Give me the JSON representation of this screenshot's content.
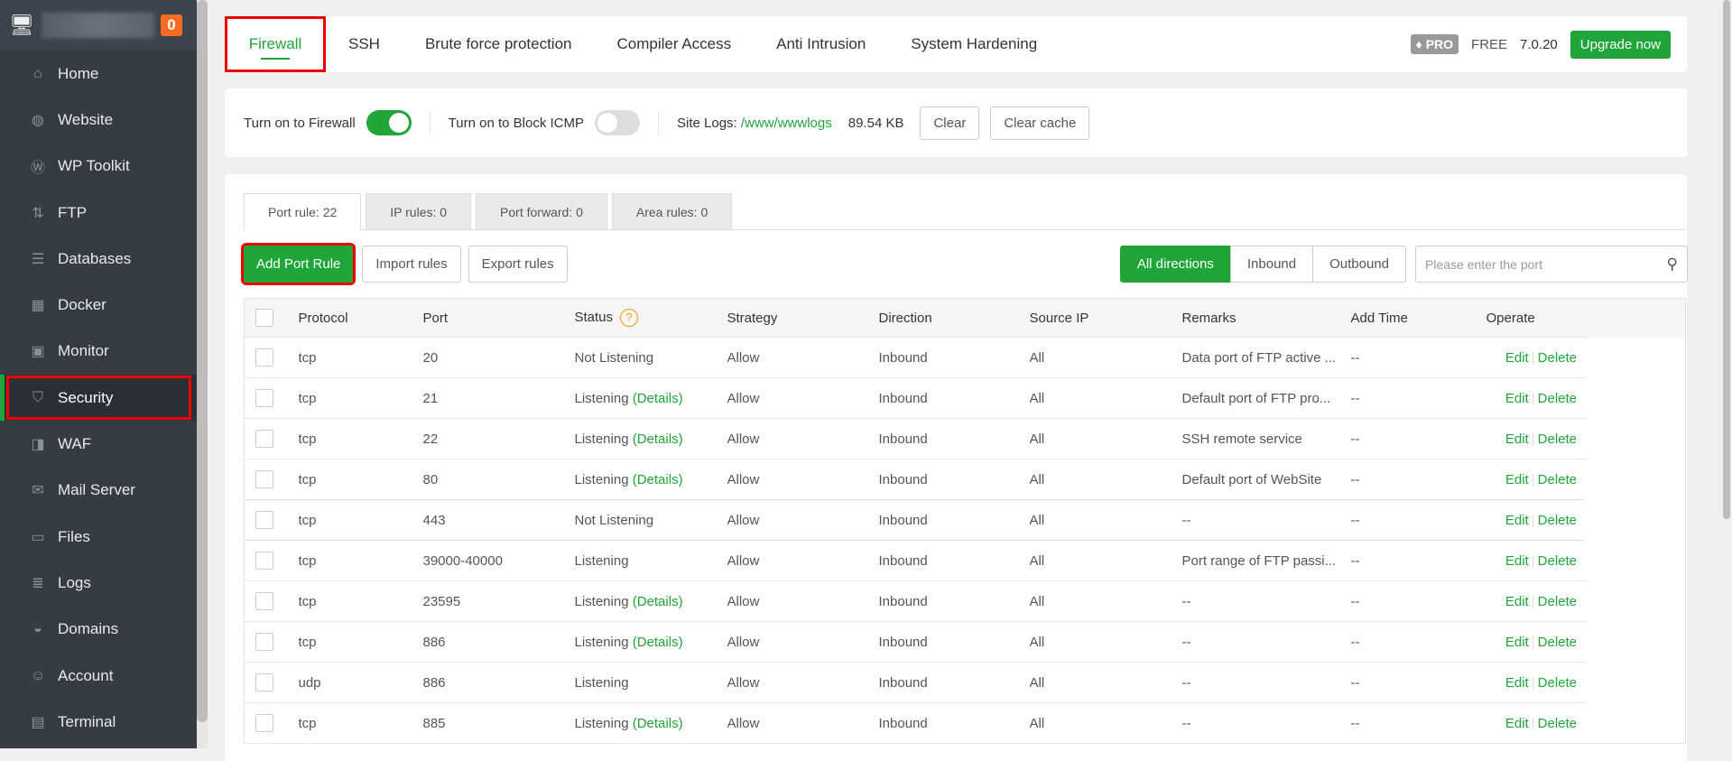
{
  "sidebar": {
    "notification_count": "0",
    "items": [
      {
        "label": "Home",
        "icon": "home-icon"
      },
      {
        "label": "Website",
        "icon": "globe-icon"
      },
      {
        "label": "WP Toolkit",
        "icon": "wordpress-icon"
      },
      {
        "label": "FTP",
        "icon": "ftp-icon"
      },
      {
        "label": "Databases",
        "icon": "database-icon"
      },
      {
        "label": "Docker",
        "icon": "docker-icon"
      },
      {
        "label": "Monitor",
        "icon": "monitor-icon"
      },
      {
        "label": "Security",
        "icon": "shield-icon"
      },
      {
        "label": "WAF",
        "icon": "waf-icon"
      },
      {
        "label": "Mail Server",
        "icon": "mail-icon"
      },
      {
        "label": "Files",
        "icon": "folder-icon"
      },
      {
        "label": "Logs",
        "icon": "logs-icon"
      },
      {
        "label": "Domains",
        "icon": "domains-icon"
      },
      {
        "label": "Account",
        "icon": "account-icon"
      },
      {
        "label": "Terminal",
        "icon": "terminal-icon"
      }
    ]
  },
  "tabs": [
    "Firewall",
    "SSH",
    "Brute force protection",
    "Compiler Access",
    "Anti Intrusion",
    "System Hardening"
  ],
  "header": {
    "pro": "PRO",
    "edition": "FREE",
    "version": "7.0.20",
    "upgrade": "Upgrade now"
  },
  "options": {
    "firewall_label": "Turn on to Firewall",
    "firewall_on": true,
    "icmp_label": "Turn on to Block ICMP",
    "icmp_on": false,
    "site_logs_label": "Site Logs:",
    "site_logs_path": "/www/wwwlogs",
    "site_logs_size": "89.54 KB",
    "clear": "Clear",
    "clear_cache": "Clear cache"
  },
  "subtabs": [
    "Port rule: 22",
    "IP rules: 0",
    "Port forward: 0",
    "Area rules: 0"
  ],
  "toolbar": {
    "add": "Add Port Rule",
    "import": "Import rules",
    "export": "Export rules",
    "directions": [
      "All directions",
      "Inbound",
      "Outbound"
    ],
    "search_placeholder": "Please enter the port"
  },
  "table": {
    "headers": [
      "Protocol",
      "Port",
      "Status",
      "Strategy",
      "Direction",
      "Source IP",
      "Remarks",
      "Add Time",
      "Operate"
    ],
    "details": "(Details)",
    "edit": "Edit",
    "delete": "Delete",
    "rows": [
      {
        "protocol": "tcp",
        "port": "20",
        "status": "Not Listening",
        "details": false,
        "strategy": "Allow",
        "direction": "Inbound",
        "source": "All",
        "remarks": "Data port of FTP active ...",
        "time": "--"
      },
      {
        "protocol": "tcp",
        "port": "21",
        "status": "Listening",
        "details": true,
        "strategy": "Allow",
        "direction": "Inbound",
        "source": "All",
        "remarks": "Default port of FTP pro...",
        "time": "--"
      },
      {
        "protocol": "tcp",
        "port": "22",
        "status": "Listening",
        "details": true,
        "strategy": "Allow",
        "direction": "Inbound",
        "source": "All",
        "remarks": "SSH remote service",
        "time": "--"
      },
      {
        "protocol": "tcp",
        "port": "80",
        "status": "Listening",
        "details": true,
        "strategy": "Allow",
        "direction": "Inbound",
        "source": "All",
        "remarks": "Default port of WebSite",
        "time": "--"
      },
      {
        "protocol": "tcp",
        "port": "443",
        "status": "Not Listening",
        "details": false,
        "strategy": "Allow",
        "direction": "Inbound",
        "source": "All",
        "remarks": "--",
        "time": "--"
      },
      {
        "protocol": "tcp",
        "port": "39000-40000",
        "status": "Listening",
        "details": false,
        "strategy": "Allow",
        "direction": "Inbound",
        "source": "All",
        "remarks": "Port range of FTP passi...",
        "time": "--"
      },
      {
        "protocol": "tcp",
        "port": "23595",
        "status": "Listening",
        "details": true,
        "strategy": "Allow",
        "direction": "Inbound",
        "source": "All",
        "remarks": "--",
        "time": "--"
      },
      {
        "protocol": "tcp",
        "port": "886",
        "status": "Listening",
        "details": true,
        "strategy": "Allow",
        "direction": "Inbound",
        "source": "All",
        "remarks": "--",
        "time": "--"
      },
      {
        "protocol": "udp",
        "port": "886",
        "status": "Listening",
        "details": false,
        "strategy": "Allow",
        "direction": "Inbound",
        "source": "All",
        "remarks": "--",
        "time": "--"
      },
      {
        "protocol": "tcp",
        "port": "885",
        "status": "Listening",
        "details": true,
        "strategy": "Allow",
        "direction": "Inbound",
        "source": "All",
        "remarks": "--",
        "time": "--"
      }
    ]
  },
  "colors": {
    "accent": "#20a53a",
    "sidebar": "#363c44",
    "badge": "#f36c21"
  }
}
